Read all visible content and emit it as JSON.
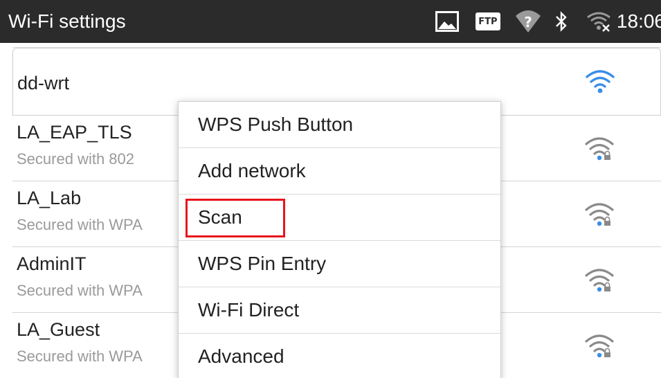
{
  "statusbar": {
    "title": "Wi-Fi settings",
    "time": "18:06",
    "ftp_label": "FTP",
    "icons": [
      "image-icon",
      "ftp-icon",
      "signal-unknown-icon",
      "bluetooth-icon",
      "wifi-x-icon"
    ]
  },
  "colors": {
    "statusbar_bg": "#2b2b2b",
    "wifi_connected": "#3a8ee6",
    "wifi_secured": "#8a8a8a",
    "highlight_box": "#e8141b"
  },
  "networks": [
    {
      "name": "dd-wrt",
      "subtitle": "",
      "icon": "wifi-connected-icon"
    },
    {
      "name": "LA_EAP_TLS",
      "subtitle": "Secured with 802",
      "icon": "wifi-secured-icon"
    },
    {
      "name": "LA_Lab",
      "subtitle": "Secured with WPA",
      "icon": "wifi-secured-icon"
    },
    {
      "name": "AdminIT",
      "subtitle": "Secured with WPA",
      "icon": "wifi-secured-icon"
    },
    {
      "name": "LA_Guest",
      "subtitle": "Secured with WPA",
      "icon": "wifi-secured-icon"
    }
  ],
  "menu": {
    "items": [
      {
        "label": "WPS Push Button"
      },
      {
        "label": "Add network"
      },
      {
        "label": "Scan",
        "highlighted": true
      },
      {
        "label": "WPS Pin Entry"
      },
      {
        "label": "Wi-Fi Direct"
      },
      {
        "label": "Advanced"
      }
    ]
  }
}
